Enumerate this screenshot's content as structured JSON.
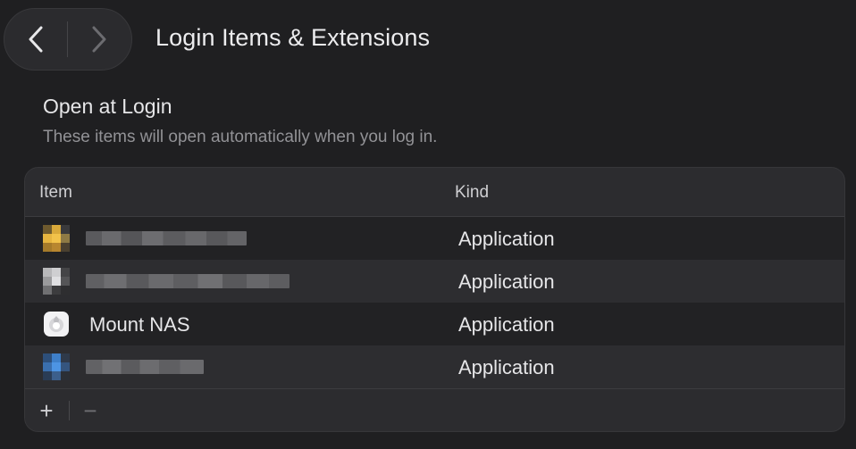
{
  "header": {
    "title": "Login Items & Extensions",
    "back_icon": "chevron-left-icon",
    "forward_icon": "chevron-right-icon"
  },
  "section": {
    "title": "Open at Login",
    "subtitle": "These items will open automatically when you log in."
  },
  "table": {
    "columns": {
      "item": "Item",
      "kind": "Kind"
    },
    "rows": [
      {
        "name": "",
        "name_redacted": true,
        "icon": "redacted-app-icon",
        "kind": "Application"
      },
      {
        "name": "",
        "name_redacted": true,
        "icon": "redacted-app-icon",
        "kind": "Application"
      },
      {
        "name": "Mount NAS",
        "name_redacted": false,
        "icon": "script-app-icon",
        "kind": "Application"
      },
      {
        "name": "",
        "name_redacted": true,
        "icon": "redacted-app-icon",
        "kind": "Application"
      }
    ]
  },
  "footer": {
    "add_label": "+",
    "remove_label": "−"
  },
  "colors": {
    "background": "#1f1f21",
    "panel": "#2c2c2f",
    "text_primary": "#e6e6e8",
    "text_secondary": "#929296"
  }
}
